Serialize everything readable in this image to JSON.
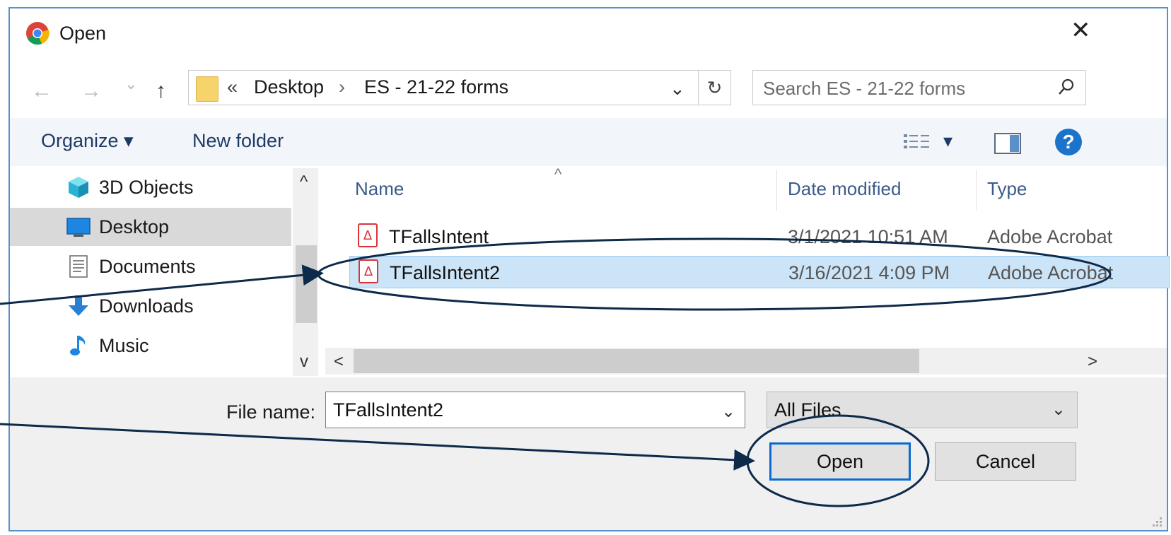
{
  "window": {
    "title": "Open",
    "close_symbol": "✕"
  },
  "navigation": {
    "back_symbol": "←",
    "forward_symbol": "→",
    "recent_symbol": "⌄",
    "up_symbol": "↑",
    "breadcrumb_prefix": "«",
    "breadcrumb": [
      "Desktop",
      "ES - 21-22 forms"
    ],
    "breadcrumb_sep": "›",
    "dropdown_symbol": "⌄",
    "refresh_symbol": "↻"
  },
  "search": {
    "placeholder": "Search ES - 21-22 forms"
  },
  "toolbar": {
    "organize_label": "Organize ▾",
    "new_folder_label": "New folder",
    "view_caret": "▾",
    "help_label": "?"
  },
  "nav_pane": {
    "items": [
      {
        "label": "3D Objects",
        "icon": "3d-objects-icon"
      },
      {
        "label": "Desktop",
        "icon": "desktop-icon",
        "selected": true
      },
      {
        "label": "Documents",
        "icon": "documents-icon"
      },
      {
        "label": "Downloads",
        "icon": "downloads-icon"
      },
      {
        "label": "Music",
        "icon": "music-icon"
      }
    ],
    "scroll_up": "^",
    "scroll_down": "v"
  },
  "file_list": {
    "columns": [
      "Name",
      "Date modified",
      "Type"
    ],
    "sort_caret": "^",
    "rows": [
      {
        "name": "TFallsIntent",
        "date": "3/1/2021 10:51 AM",
        "type": "Adobe Acrobat"
      },
      {
        "name": "TFallsIntent2",
        "date": "3/16/2021 4:09 PM",
        "type": "Adobe Acrobat",
        "selected": true
      }
    ],
    "scroll_left": "<",
    "scroll_right": ">"
  },
  "footer": {
    "file_name_label": "File name:",
    "file_name_value": "TFallsIntent2",
    "file_type_value": "All Files",
    "dropdown_symbol": "⌄",
    "open_label": "Open",
    "cancel_label": "Cancel"
  },
  "colors": {
    "accent": "#0a6ad1",
    "selection": "#cce4f7",
    "annotation": "#0e2a4a"
  }
}
